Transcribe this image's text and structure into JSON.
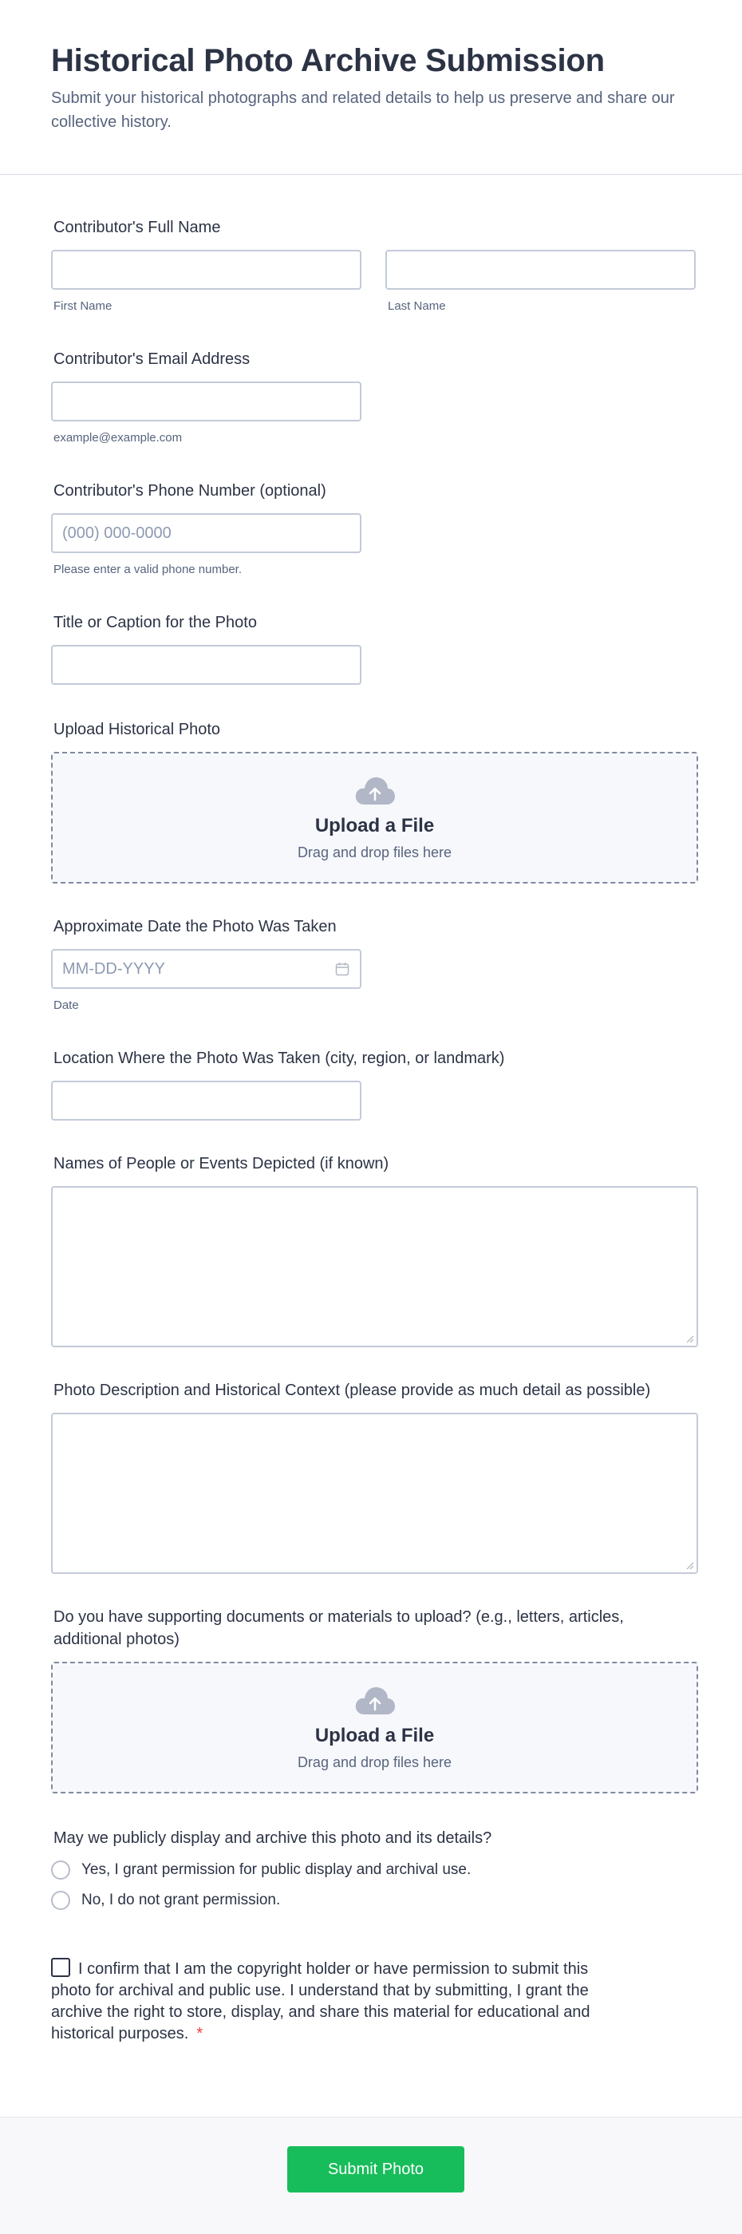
{
  "form": {
    "title": "Historical Photo Archive Submission",
    "subtitle": "Submit your historical photographs and related details to help us preserve and share our collective history."
  },
  "fields": {
    "full_name": {
      "label": "Contributor's Full Name",
      "first_sublabel": "First Name",
      "last_sublabel": "Last Name",
      "first_value": "",
      "last_value": ""
    },
    "email": {
      "label": "Contributor's Email Address",
      "sublabel": "example@example.com",
      "value": ""
    },
    "phone": {
      "label": "Contributor's Phone Number (optional)",
      "placeholder": "(000) 000-0000",
      "sublabel": "Please enter a valid phone number.",
      "value": ""
    },
    "title_caption": {
      "label": "Title or Caption for the Photo",
      "value": ""
    },
    "upload_photo": {
      "label": "Upload Historical Photo",
      "title": "Upload a File",
      "sub": "Drag and drop files here"
    },
    "date_taken": {
      "label": "Approximate Date the Photo Was Taken",
      "placeholder": "MM-DD-YYYY",
      "sublabel": "Date",
      "value": ""
    },
    "location": {
      "label": "Location Where the Photo Was Taken (city, region, or landmark)",
      "value": ""
    },
    "people_events": {
      "label": "Names of People or Events Depicted (if known)",
      "value": ""
    },
    "description": {
      "label": "Photo Description and Historical Context (please provide as much detail as possible)",
      "value": ""
    },
    "supporting_docs": {
      "label": "Do you have supporting documents or materials to upload? (e.g., letters, articles, additional photos)",
      "title": "Upload a File",
      "sub": "Drag and drop files here"
    },
    "permission": {
      "label": "May we publicly display and archive this photo and its details?",
      "options": [
        "Yes, I grant permission for public display and archival use.",
        "No, I do not grant permission."
      ]
    },
    "consent": {
      "text": "I confirm that I am the copyright holder or have permission to submit this photo for archival and public use. I understand that by submitting, I grant the archive the right to store, display, and share this material for educational and historical purposes.",
      "required_mark": "*"
    }
  },
  "submit": {
    "label": "Submit Photo"
  },
  "icons": {
    "upload": "cloud-upload-icon",
    "calendar": "calendar-icon"
  },
  "colors": {
    "accent": "#18bd5b",
    "required": "#f23a3c",
    "text": "#2c3345",
    "muted": "#57647e",
    "border": "#c3cad8"
  }
}
